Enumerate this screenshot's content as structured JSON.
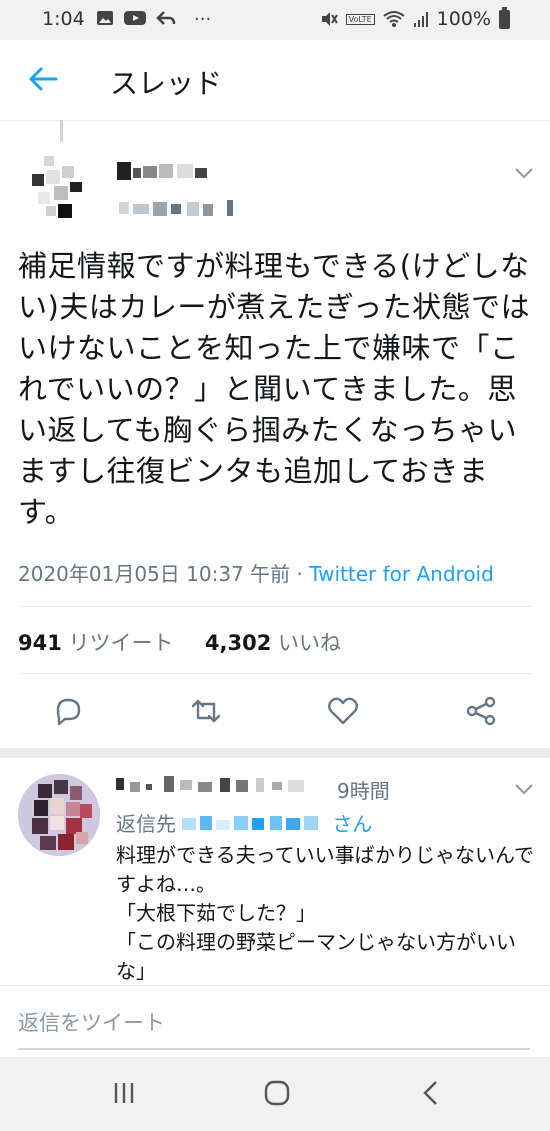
{
  "status_bar": {
    "time": "1:04",
    "left_icons": [
      "image-icon",
      "youtube-icon",
      "reply-arrow-icon",
      "more-icon"
    ],
    "dots": "···",
    "battery": "100%",
    "volte": "VoLTE"
  },
  "header": {
    "title": "スレッド"
  },
  "tweet": {
    "text": "補足情報ですが料理もできる(けどしない)夫はカレーが煮えたぎった状態ではいけないことを知った上で嫌味で「これでいいの？」と聞いてきました。思い返しても胸ぐら掴みたくなっちゃいますし往復ビンタも追加しておきます。",
    "timestamp": "2020年01月05日 10:37 午前 · ",
    "source": "Twitter for Android",
    "retweets_count": "941",
    "retweets_label": " リツイート",
    "likes_count": "4,302",
    "likes_label": " いいね"
  },
  "reply": {
    "time": "9時間",
    "reply_to_prefix": "返信先 ",
    "reply_to_suffix": "さん",
    "text_lines": [
      "料理ができる夫っていい事ばかりじゃないんですよね…。",
      "「大根下茹でした？」",
      "「この料理の野菜ピーマンじゃない方がいいな」"
    ]
  },
  "compose": {
    "placeholder": "返信をツイート"
  },
  "colors": {
    "accent": "#1da1f2",
    "secondary_text": "#657786",
    "divider": "#e6ecf0"
  }
}
